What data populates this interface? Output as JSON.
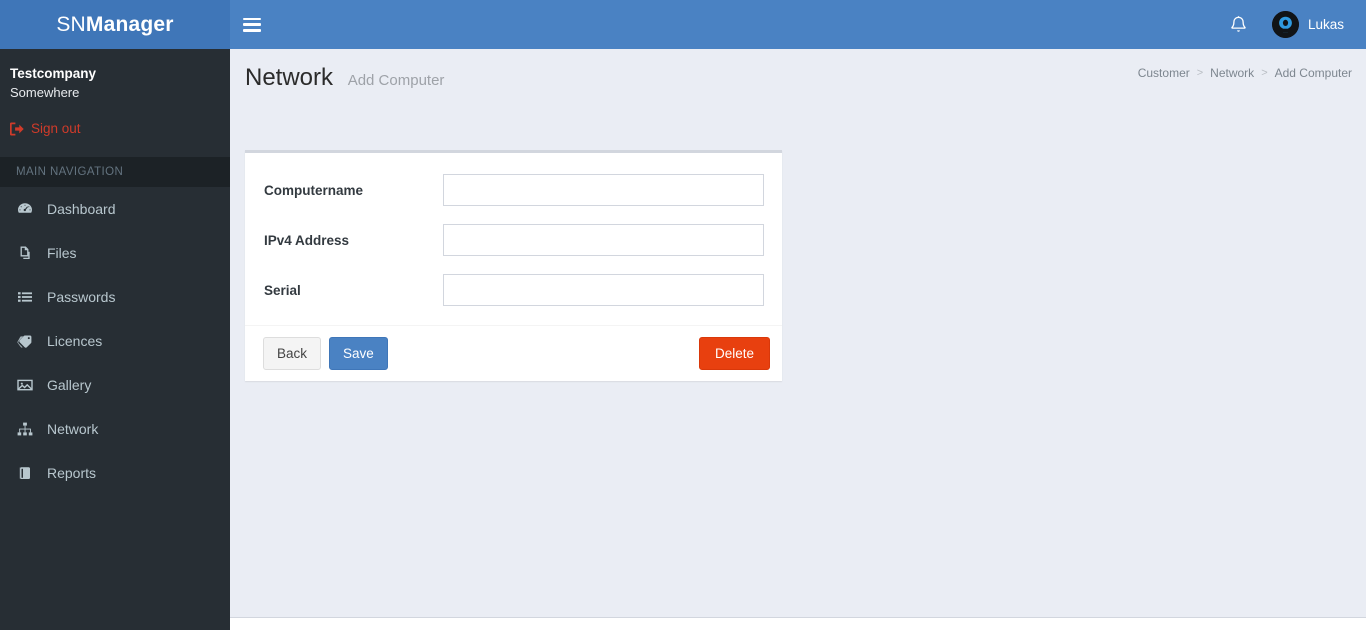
{
  "header": {
    "logo_light": "SN",
    "logo_bold": "Manager",
    "toggle_label": "Toggle navigation",
    "notifications_icon": "bell-icon",
    "user_name": "Lukas"
  },
  "sidebar": {
    "company": "Testcompany",
    "location": "Somewhere",
    "signout_label": "Sign out",
    "nav_header": "MAIN NAVIGATION",
    "items": [
      {
        "label": "Dashboard",
        "icon": "dashboard-icon"
      },
      {
        "label": "Files",
        "icon": "files-icon"
      },
      {
        "label": "Passwords",
        "icon": "list-icon"
      },
      {
        "label": "Licences",
        "icon": "tag-icon"
      },
      {
        "label": "Gallery",
        "icon": "image-icon"
      },
      {
        "label": "Network",
        "icon": "sitemap-icon"
      },
      {
        "label": "Reports",
        "icon": "book-icon"
      }
    ]
  },
  "content": {
    "title": "Network",
    "subtitle": "Add Computer",
    "breadcrumb": [
      {
        "label": "Customer"
      },
      {
        "label": "Network"
      },
      {
        "label": "Add Computer"
      }
    ],
    "breadcrumb_separator": ">",
    "form": {
      "fields": [
        {
          "label": "Computername",
          "value": "",
          "placeholder": ""
        },
        {
          "label": "IPv4 Address",
          "value": "",
          "placeholder": ""
        },
        {
          "label": "Serial",
          "value": "",
          "placeholder": ""
        }
      ],
      "buttons": {
        "back": "Back",
        "save": "Save",
        "delete": "Delete"
      }
    }
  },
  "colors": {
    "header_blue": "#4a82c3",
    "logo_blue": "#3f76b8",
    "sidebar_dark": "#272e34",
    "nav_header_dark": "#1c2226",
    "signout_red": "#cf3b2a",
    "content_bg": "#eaedf4",
    "danger_red": "#e8400f",
    "border_gray": "#d2d6de"
  }
}
